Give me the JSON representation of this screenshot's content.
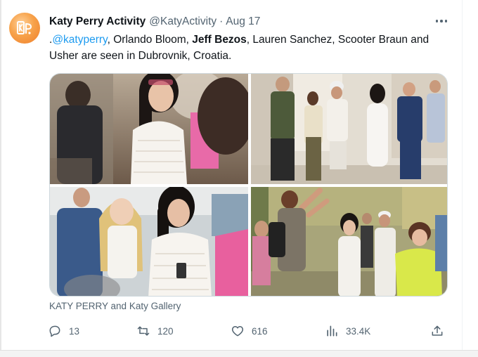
{
  "author": {
    "display_name": "Katy Perry Activity",
    "handle": "@KatyActivity",
    "separator": "·",
    "date": "Aug 17",
    "avatar_icon": "kp-activity-logo"
  },
  "tweet": {
    "prefix": ".",
    "mention": "@katyperry",
    "text_1": ", Orlando Bloom, ",
    "bold_name": "Jeff Bezos",
    "text_2": ", Lauren Sanchez, Scooter Braun and Usher are seen in Dubrovnik, Croatia."
  },
  "media": {
    "photos": [
      {
        "name": "photo-katy-crowd",
        "icon": "photo"
      },
      {
        "name": "photo-group-walking",
        "icon": "photo"
      },
      {
        "name": "photo-katy-phone",
        "icon": "photo"
      },
      {
        "name": "photo-courtyard-group",
        "icon": "photo"
      }
    ],
    "caption": "KATY PERRY and Katy Gallery"
  },
  "actions": {
    "reply": {
      "icon": "reply-icon",
      "count": "13"
    },
    "retweet": {
      "icon": "retweet-icon",
      "count": "120"
    },
    "like": {
      "icon": "heart-icon",
      "count": "616"
    },
    "views": {
      "icon": "views-icon",
      "count": "33.4K"
    },
    "share": {
      "icon": "share-icon"
    }
  },
  "colors": {
    "text": "#0f1419",
    "muted": "#536471",
    "link": "#1d9bf0",
    "avatar": "#f7a24a"
  }
}
